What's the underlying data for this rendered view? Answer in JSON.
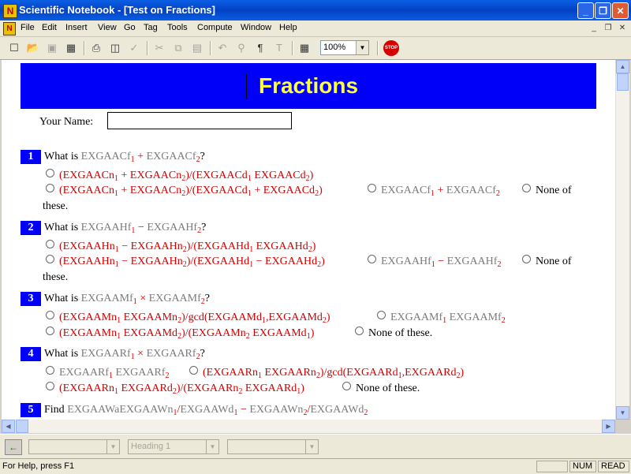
{
  "window": {
    "app_icon": "N",
    "title": "Scientific Notebook - [Test on Fractions]",
    "minimize": "_",
    "maximize": "❐",
    "close": "✕"
  },
  "menu": {
    "doc_icon": "N",
    "items": [
      "File",
      "Edit",
      "Insert",
      "View",
      "Go",
      "Tag",
      "Tools",
      "Compute",
      "Window",
      "Help"
    ],
    "mdi_minimize": "_",
    "mdi_restore": "❐",
    "mdi_close": "✕"
  },
  "toolbar": {
    "zoom": "100%",
    "icons": [
      "new-icon",
      "open-icon",
      "save-icon",
      "export-icon",
      "print-icon",
      "print-preview-icon",
      "spellcheck-icon",
      "cut-icon",
      "copy-icon",
      "paste-icon",
      "undo-icon",
      "find-icon",
      "paragraph-icon",
      "text-icon",
      "table-icon",
      "stop-icon"
    ],
    "stop_label": "STOP"
  },
  "doc": {
    "heading": "Fractions",
    "name_label": "Your Name:",
    "name_value": "",
    "questions": [
      {
        "num": "1",
        "prompt": "What is",
        "a": "EXGAACf",
        "a_sub": "1",
        "op": "+",
        "b": "EXGAACf",
        "b_sub": "2",
        "q": "?",
        "opt1": {
          "t1": "(EXGAACn",
          "s1": "1",
          "op1": "+",
          "t2": "EXGAACn",
          "s2": "2",
          "mid": ")/(",
          "t3": "EXGAACd",
          "s3": "1",
          "op2": "",
          "t4": "EXGAACd",
          "s4": "2",
          "end": ")"
        },
        "opt2": {
          "t1": "(EXGAACn",
          "s1": "1",
          "op1": "+",
          "t2": "EXGAACn",
          "s2": "2",
          "mid": ")/(",
          "t3": "EXGAACd",
          "s3": "1",
          "op2": "+",
          "t4": "EXGAACd",
          "s4": "2",
          "end": ")"
        },
        "opt3": {
          "t1": "EXGAACf",
          "s1": "1",
          "op1": "+",
          "t2": "EXGAACf",
          "s2": "2"
        },
        "none": "None of",
        "none2": "these."
      },
      {
        "num": "2",
        "prompt": "What is",
        "a": "EXGAAHf",
        "a_sub": "1",
        "op": "−",
        "b": "EXGAAHf",
        "b_sub": "2",
        "q": "?",
        "opt1": {
          "t1": "(EXGAAHn",
          "s1": "1",
          "op1": "−",
          "t2": "EXGAAHn",
          "s2": "2",
          "mid": ")/(",
          "t3": "EXGAAHd",
          "s3": "1",
          "op2": "",
          "t4": "EXGAAHd",
          "s4": "2",
          "end": ")"
        },
        "opt2": {
          "t1": "(EXGAAHn",
          "s1": "1",
          "op1": "−",
          "t2": "EXGAAHn",
          "s2": "2",
          "mid": ")/(",
          "t3": "EXGAAHd",
          "s3": "1",
          "op2": "−",
          "t4": "EXGAAHd",
          "s4": "2",
          "end": ")"
        },
        "opt3": {
          "t1": "EXGAAHf",
          "s1": "1",
          "op1": "−",
          "t2": "EXGAAHf",
          "s2": "2"
        },
        "none": "None of",
        "none2": "these."
      },
      {
        "num": "3",
        "prompt": "What is",
        "a": "EXGAAMf",
        "a_sub": "1",
        "op": "×",
        "b": "EXGAAMf",
        "b_sub": "2",
        "q": "?",
        "opt1": {
          "t1": "(EXGAAMn",
          "s1": "1",
          "t2": "EXGAAMn",
          "s2": "2",
          "mid": ")/gcd(",
          "t3": "EXGAAMd",
          "s3": "1",
          "comma": ",",
          "t4": "EXGAAMd",
          "s4": "2",
          "end": ")"
        },
        "opt2": {
          "t1": "EXGAAMf",
          "s1": "1",
          "t2": "EXGAAMf",
          "s2": "2"
        },
        "opt3": {
          "t1": "(EXGAAMn",
          "s1": "1",
          "t2": "EXGAAMd",
          "s2": "2",
          "mid": ")/(",
          "t3": "EXGAAMn",
          "s3": "2",
          "t4": "EXGAAMd",
          "s4": "1",
          "end": ")"
        },
        "none": "None of these."
      },
      {
        "num": "4",
        "prompt": "What is",
        "a": "EXGAARf",
        "a_sub": "1",
        "op": "×",
        "b": "EXGAARf",
        "b_sub": "2",
        "q": "?",
        "opt1": {
          "t1": "EXGAARf",
          "s1": "1",
          "t2": "EXGAARf",
          "s2": "2"
        },
        "opt2": {
          "t1": "(EXGAARn",
          "s1": "1",
          "t2": "EXGAARn",
          "s2": "2",
          "mid": ")/gcd(",
          "t3": "EXGAARd",
          "s3": "1",
          "comma": ",",
          "t4": "EXGAARd",
          "s4": "2",
          "end": ")"
        },
        "opt3": {
          "t1": "(EXGAARn",
          "s1": "1",
          "t2": "EXGAARd",
          "s2": "2",
          "mid": ")/(",
          "t3": "EXGAARn",
          "s3": "2",
          "t4": "EXGAARd",
          "s4": "1",
          "end": ")"
        },
        "none": "None of these."
      },
      {
        "num": "5",
        "prompt": "Find",
        "t1": "EXGAAWaEXGAAWn",
        "s1": "1",
        "sl1": "/",
        "t2": "EXGAAWd",
        "s2": "1",
        "op": "−",
        "t3": "EXGAAWn",
        "s3": "2",
        "sl2": "/",
        "t4": "EXGAAWd",
        "s4": "2"
      }
    ]
  },
  "bottombar": {
    "back_icon": "←",
    "combo1": "",
    "combo2": "Heading 1",
    "combo3": ""
  },
  "status": {
    "message": "For Help, press F1",
    "num": "NUM",
    "read": "READ"
  },
  "colors": {
    "titlebar": "#0a5fe4",
    "banner": "#0000fa",
    "heading_text": "#ffff3c",
    "math_var": "#7b7b7b",
    "math_op": "#d40000"
  }
}
